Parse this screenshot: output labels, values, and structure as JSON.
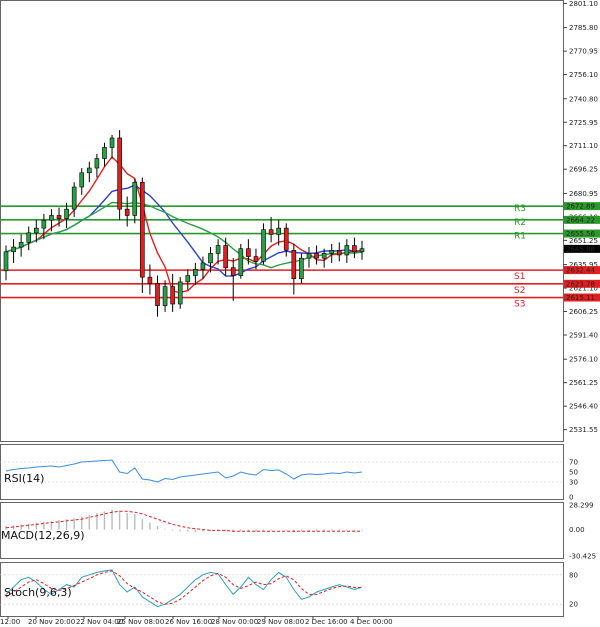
{
  "chart_data": {
    "type": "candlestick",
    "instrument_note": "",
    "price_axis": {
      "range": [
        2525,
        2802
      ],
      "ticks": [
        "2801.10",
        "2785.80",
        "2770.95",
        "2756.10",
        "2740.80",
        "2725.95",
        "2711.10",
        "2696.25",
        "2680.95",
        "2666.10",
        "2651.25",
        "2635.95",
        "2621.10",
        "2606.25",
        "2591.40",
        "2576.10",
        "2561.25",
        "2546.40",
        "2531.55"
      ]
    },
    "time_axis": {
      "labels": [
        "19 Nov 12:00",
        "20 Nov 20:00",
        "22 Nov 04:00",
        "25 Nov 08:00",
        "26 Nov 16:00",
        "28 Nov 00:00",
        "29 Nov 08:00",
        "2 Dec 16:00",
        "4 Dec 00:00"
      ]
    },
    "candles": [
      [
        2632,
        2648,
        2626,
        2644
      ],
      [
        2644,
        2652,
        2637,
        2647
      ],
      [
        2647,
        2655,
        2641,
        2650
      ],
      [
        2650,
        2660,
        2645,
        2656
      ],
      [
        2656,
        2664,
        2650,
        2659
      ],
      [
        2659,
        2668,
        2652,
        2664
      ],
      [
        2664,
        2671,
        2657,
        2667
      ],
      [
        2667,
        2672,
        2660,
        2665
      ],
      [
        2665,
        2675,
        2659,
        2671
      ],
      [
        2671,
        2688,
        2666,
        2685
      ],
      [
        2685,
        2697,
        2680,
        2694
      ],
      [
        2694,
        2701,
        2688,
        2697
      ],
      [
        2697,
        2706,
        2691,
        2703
      ],
      [
        2703,
        2713,
        2698,
        2710
      ],
      [
        2710,
        2718,
        2703,
        2716
      ],
      [
        2716,
        2721,
        2664,
        2671
      ],
      [
        2671,
        2679,
        2660,
        2667
      ],
      [
        2667,
        2690,
        2662,
        2688
      ],
      [
        2688,
        2691,
        2618,
        2628
      ],
      [
        2628,
        2636,
        2617,
        2624
      ],
      [
        2624,
        2629,
        2603,
        2610
      ],
      [
        2610,
        2626,
        2606,
        2622
      ],
      [
        2622,
        2630,
        2606,
        2611
      ],
      [
        2611,
        2628,
        2608,
        2625
      ],
      [
        2625,
        2633,
        2620,
        2629
      ],
      [
        2629,
        2637,
        2623,
        2633
      ],
      [
        2633,
        2641,
        2627,
        2637
      ],
      [
        2637,
        2647,
        2631,
        2643
      ],
      [
        2643,
        2652,
        2636,
        2648
      ],
      [
        2648,
        2653,
        2629,
        2634
      ],
      [
        2634,
        2640,
        2613,
        2629
      ],
      [
        2629,
        2649,
        2627,
        2646
      ],
      [
        2646,
        2652,
        2636,
        2641
      ],
      [
        2641,
        2646,
        2633,
        2638
      ],
      [
        2638,
        2662,
        2636,
        2658
      ],
      [
        2658,
        2666,
        2650,
        2655
      ],
      [
        2655,
        2664,
        2648,
        2659
      ],
      [
        2659,
        2662,
        2641,
        2645
      ],
      [
        2645,
        2649,
        2617,
        2627
      ],
      [
        2627,
        2643,
        2624,
        2640
      ],
      [
        2640,
        2647,
        2634,
        2643
      ],
      [
        2643,
        2648,
        2636,
        2640
      ],
      [
        2640,
        2646,
        2634,
        2643
      ],
      [
        2643,
        2649,
        2637,
        2645
      ],
      [
        2645,
        2650,
        2638,
        2642
      ],
      [
        2642,
        2652,
        2637,
        2648
      ],
      [
        2648,
        2653,
        2640,
        2644
      ],
      [
        2644,
        2651,
        2639,
        2646
      ]
    ],
    "indicators_overlay": [
      {
        "name": "",
        "color": "#e02020"
      },
      {
        "name": "",
        "color": "#2e40d0"
      },
      {
        "name": "",
        "color": "#2aa046"
      }
    ],
    "levels": [
      {
        "label": "R3",
        "value": "2672.89",
        "price": 2672.89,
        "color": "#2a9a2a"
      },
      {
        "label": "R2",
        "value": "2664.22",
        "price": 2664.22,
        "color": "#2a9a2a"
      },
      {
        "label": "R1",
        "value": "2655.56",
        "price": 2655.56,
        "color": "#2a9a2a"
      },
      {
        "label": "S1",
        "value": "2632.44",
        "price": 2632.44,
        "color": "#e02020"
      },
      {
        "label": "S2",
        "value": "2623.78",
        "price": 2623.78,
        "color": "#e02020"
      },
      {
        "label": "S3",
        "value": "2615.11",
        "price": 2615.11,
        "color": "#e02020"
      }
    ],
    "last_price": {
      "value": "2645.88",
      "price": 2645.88
    },
    "rsi": {
      "label": "RSI(14)",
      "ticks": [
        "70",
        "50",
        "30",
        "0"
      ],
      "values": [
        52,
        55,
        57,
        58,
        60,
        61,
        62,
        60,
        63,
        66,
        70,
        71,
        72,
        73,
        74,
        50,
        47,
        58,
        36,
        34,
        30,
        37,
        35,
        40,
        42,
        44,
        46,
        48,
        50,
        38,
        42,
        50,
        46,
        44,
        55,
        53,
        54,
        46,
        36,
        44,
        46,
        45,
        46,
        48,
        47,
        50,
        48,
        50
      ]
    },
    "macd": {
      "label": "MACD(12,26,9)",
      "ticks": [
        "28.299",
        "0.00",
        "-30.425"
      ],
      "hist": [
        4,
        5,
        6,
        7,
        8,
        9,
        10,
        11,
        12,
        13,
        15,
        17,
        19,
        21,
        23,
        22,
        19,
        18,
        12,
        8,
        4,
        1,
        -1,
        -2,
        -2,
        -3,
        -2,
        -2,
        -1,
        -2,
        -3,
        -2,
        -2,
        -3,
        -1,
        -1,
        0,
        -1,
        -3,
        -2,
        -2,
        -2,
        -2,
        -1,
        -1,
        -1,
        -1,
        -1
      ],
      "signal": [
        2,
        3,
        4,
        5,
        6,
        7,
        8,
        9,
        10,
        11,
        12,
        14,
        16,
        18,
        20,
        21,
        21,
        20,
        18,
        15,
        12,
        9,
        6,
        4,
        2,
        1,
        0,
        -1,
        -1,
        -1,
        -2,
        -2,
        -2,
        -2,
        -2,
        -2,
        -2,
        -2,
        -2,
        -2,
        -2,
        -2,
        -2,
        -2,
        -2,
        -2,
        -2,
        -2
      ]
    },
    "stoch": {
      "label": "Stoch(9,6,3)",
      "ticks": [
        "80",
        "20"
      ],
      "k": [
        40,
        55,
        70,
        75,
        65,
        50,
        40,
        50,
        60,
        55,
        75,
        80,
        85,
        88,
        90,
        60,
        45,
        55,
        35,
        25,
        15,
        20,
        30,
        40,
        55,
        70,
        80,
        85,
        82,
        60,
        40,
        55,
        75,
        60,
        50,
        70,
        85,
        75,
        50,
        30,
        35,
        45,
        50,
        55,
        60,
        55,
        50,
        55
      ],
      "d": [
        35,
        45,
        55,
        65,
        70,
        62,
        52,
        48,
        52,
        58,
        65,
        72,
        80,
        85,
        88,
        78,
        62,
        52,
        45,
        35,
        25,
        20,
        22,
        30,
        42,
        55,
        68,
        78,
        83,
        75,
        60,
        52,
        58,
        65,
        60,
        62,
        72,
        78,
        70,
        52,
        40,
        40,
        46,
        52,
        56,
        57,
        54,
        54
      ]
    }
  }
}
